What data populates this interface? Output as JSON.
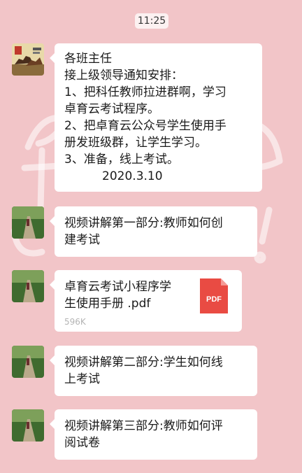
{
  "status": {
    "time": "11:25"
  },
  "messages": [
    {
      "type": "text",
      "lines": [
        "各班主任",
        "接上级领导通知安排：",
        "1、把科任教师拉进群啊，学习",
        "卓育云考试程序。",
        "2、把卓育云公众号学生使用手",
        "册发班级群，让学生学习。",
        "3、准备，线上考试。",
        "          2020.3.10"
      ]
    },
    {
      "type": "text",
      "lines": [
        "视频讲解第一部分:教师如何创",
        "建考试"
      ]
    },
    {
      "type": "file",
      "name_lines": [
        "卓育云考试小程序学",
        "生使用手册 .pdf"
      ],
      "size": "596K",
      "icon_label": "PDF"
    },
    {
      "type": "text",
      "lines": [
        "视频讲解第二部分:学生如何线",
        "上考试"
      ]
    },
    {
      "type": "text",
      "lines": [
        "视频讲解第三部分:教师如何评",
        "阅试卷"
      ]
    }
  ],
  "colors": {
    "background": "#f2c5c8",
    "bubble": "#ffffff",
    "pdf_red": "#e94b43",
    "size_gray": "#b4b4b4"
  }
}
